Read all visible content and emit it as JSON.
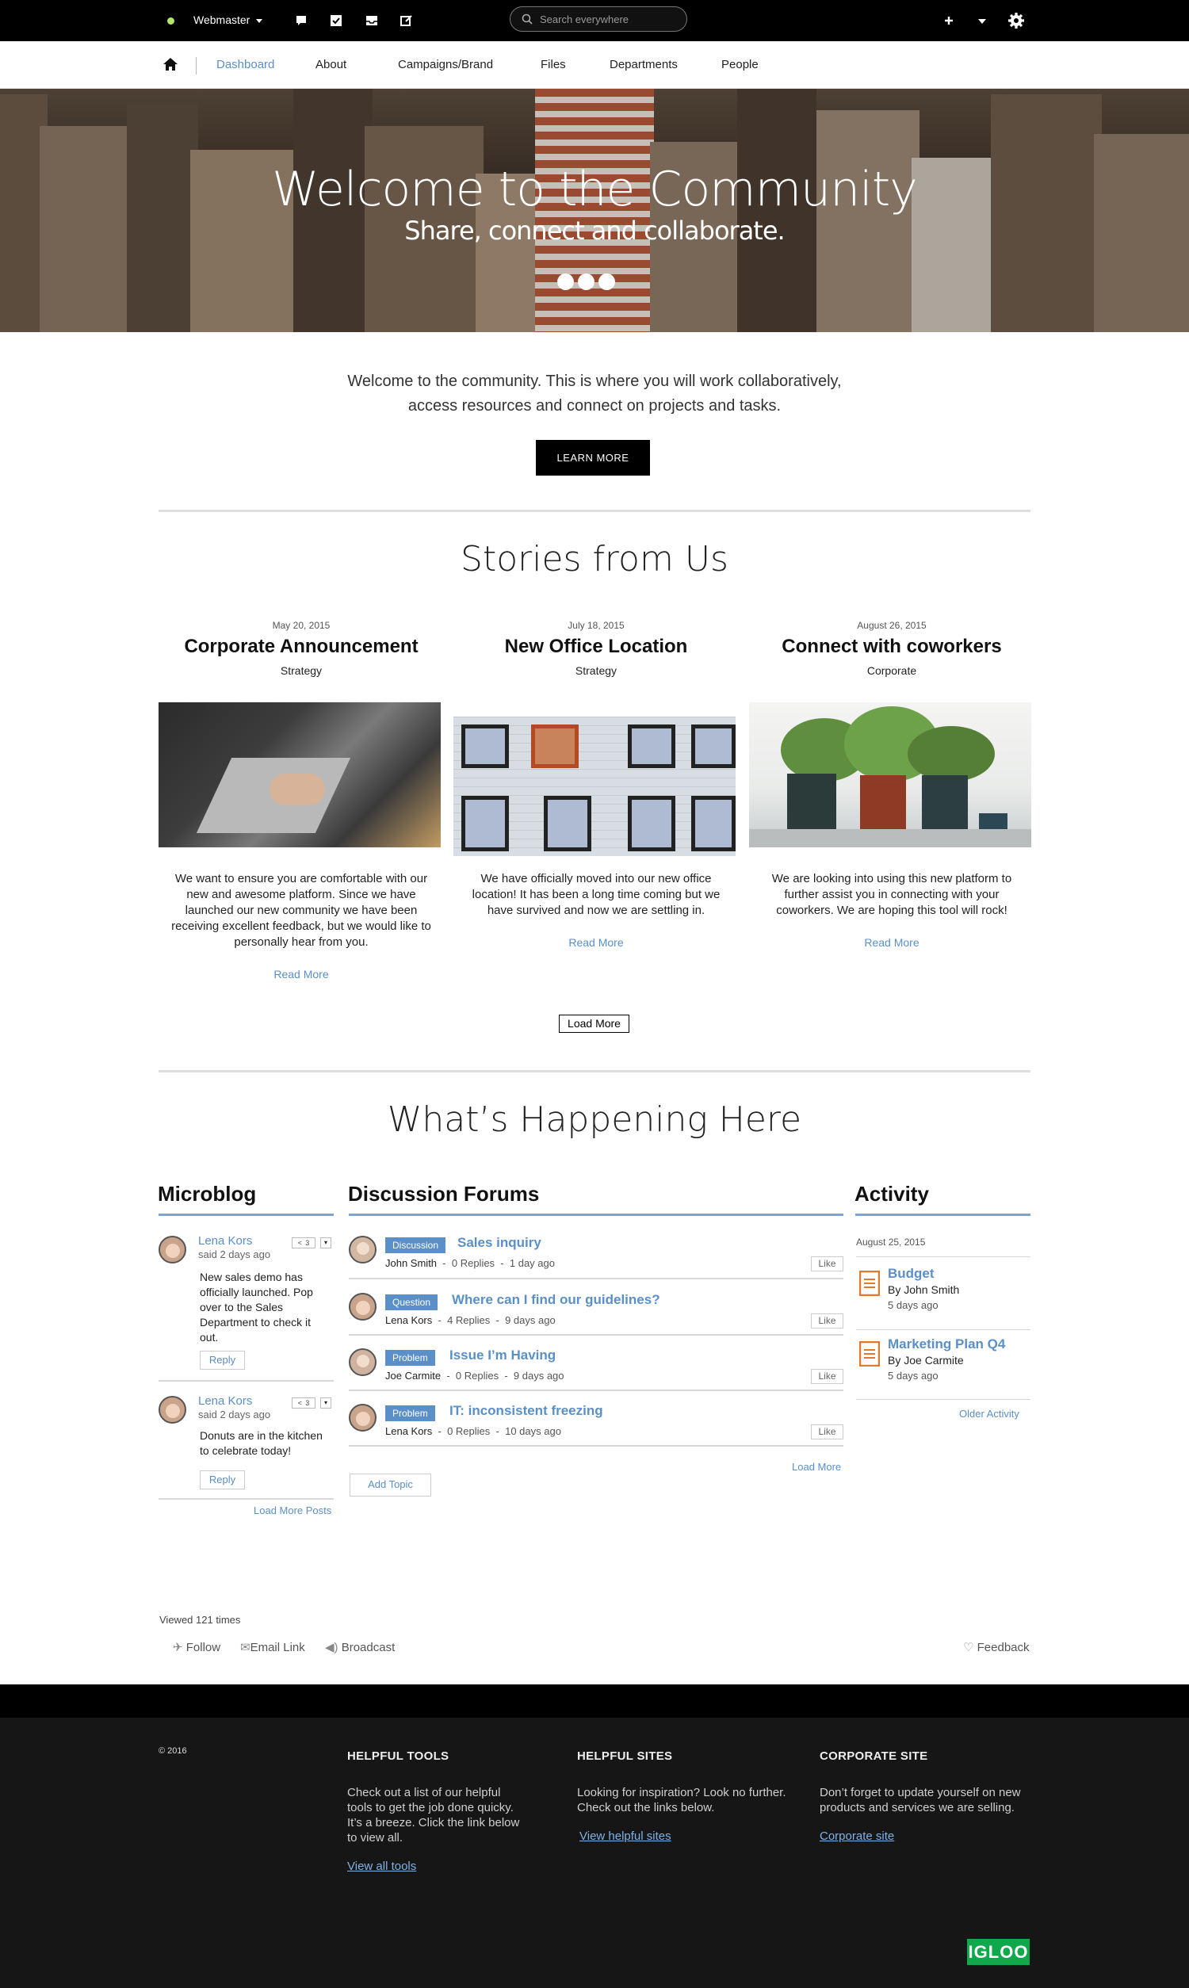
{
  "topbar": {
    "user": "Webmaster",
    "search_placeholder": "Search everywhere"
  },
  "nav": {
    "items": [
      "Dashboard",
      "About",
      "Campaigns/Brand",
      "Files",
      "Departments",
      "People"
    ]
  },
  "hero": {
    "title": "Welcome to the Community",
    "subtitle": "Share, connect and collaborate."
  },
  "intro": {
    "line1": "Welcome to the community. This is where you will work collaboratively,",
    "line2": "access resources and connect on projects and tasks.",
    "button": "LEARN MORE"
  },
  "stories": {
    "heading": "Stories from Us",
    "items": [
      {
        "date": "May 20, 2015",
        "title": "Corporate Announcement",
        "category": "Strategy",
        "body": "We want to ensure you are comfortable with our new and awesome platform. Since we have launched our new community we have been receiving excellent feedback, but we would like to personally hear from you.",
        "more": "Read More"
      },
      {
        "date": "July 18, 2015",
        "title": "New Office Location",
        "category": "Strategy",
        "body": "We have officially moved into our new office location! It has been a long time coming but we have survived and now we are settling in.",
        "more": "Read More"
      },
      {
        "date": "August 26, 2015",
        "title": "Connect with coworkers",
        "category": "Corporate",
        "body": "We are looking into using this new platform to further assist you in connecting with your coworkers. We are hoping this tool will rock!",
        "more": "Read More"
      }
    ],
    "load_more": "Load More"
  },
  "happening": {
    "heading": "What’s Happening Here",
    "microblog": {
      "title": "Microblog",
      "posts": [
        {
          "name": "Lena Kors",
          "said": "said 2 days ago",
          "share": "<  3",
          "text": "New sales demo has officially launched. Pop over to the Sales Department to check it out.",
          "reply": "Reply"
        },
        {
          "name": "Lena Kors",
          "said": "said 2 days ago",
          "share": "<  3",
          "text": "Donuts are in the kitchen to celebrate today!",
          "reply": "Reply"
        }
      ],
      "load_more": "Load More Posts"
    },
    "forums": {
      "title": "Discussion Forums",
      "topics": [
        {
          "tag": "Discussion",
          "title": "Sales inquiry",
          "author": "John Smith",
          "replies": "0 Replies",
          "time": "1 day ago",
          "like": "Like"
        },
        {
          "tag": "Question",
          "title": "Where can I find our guidelines?",
          "author": "Lena Kors",
          "replies": "4 Replies",
          "time": "9 days ago",
          "like": "Like"
        },
        {
          "tag": "Problem",
          "title": "Issue I’m Having",
          "author": "Joe Carmite",
          "replies": "0 Replies",
          "time": "9 days ago",
          "like": "Like"
        },
        {
          "tag": "Problem",
          "title": "IT: inconsistent freezing",
          "author": "Lena Kors",
          "replies": "0 Replies",
          "time": "10 days ago",
          "like": "Like"
        }
      ],
      "load_more": "Load More",
      "add_topic": "Add Topic",
      "separator": "-"
    },
    "activity": {
      "title": "Activity",
      "date": "August 25, 2015",
      "items": [
        {
          "title": "Budget",
          "by": "By John Smith",
          "ago": "5 days ago"
        },
        {
          "title": "Marketing Plan Q4",
          "by": "By Joe Carmite",
          "ago": "5 days ago"
        }
      ],
      "older": "Older Activity"
    }
  },
  "page_footer": {
    "viewed": "Viewed 121 times",
    "follow": "Follow",
    "email": "Email Link",
    "broadcast": "Broadcast",
    "feedback": "Feedback"
  },
  "footer": {
    "copyright": "© 2016",
    "cols": [
      {
        "heading": "HELPFUL TOOLS",
        "text": "Check out a list of our helpful tools to get the job done quicky. It’s a breeze. Click the link below to view all.",
        "link": "View all tools"
      },
      {
        "heading": "HELPFUL SITES",
        "text": "Looking for inspiration? Look no further. Check out the links below.",
        "link": "View helpful sites"
      },
      {
        "heading": "CORPORATE SITE",
        "text": "Don’t forget to update yourself on new products and services we are selling.",
        "link": "Corporate site"
      }
    ],
    "logo": "IGLOO"
  },
  "colors": {
    "accent": "#5b8fc7",
    "status_dot": "#b6e36a",
    "logo": "#0fa84b",
    "doc_icon": "#e07a2e"
  }
}
